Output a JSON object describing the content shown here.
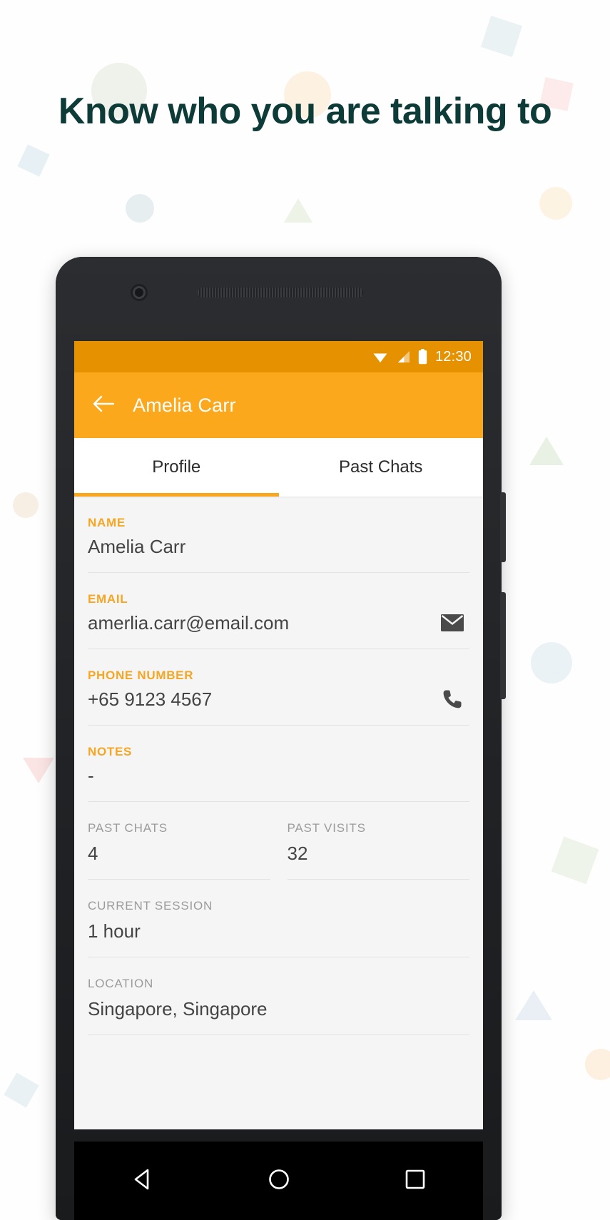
{
  "headline": "Know who you are talking to",
  "status_bar": {
    "time": "12:30",
    "icons": [
      "wifi-icon",
      "cell-signal-icon",
      "battery-icon"
    ]
  },
  "app_bar": {
    "back_icon": "back-arrow-icon",
    "title": "Amelia Carr"
  },
  "tabs": {
    "items": [
      {
        "label": "Profile",
        "active": true
      },
      {
        "label": "Past Chats",
        "active": false
      }
    ]
  },
  "profile_fields": [
    {
      "label": "NAME",
      "value": "Amelia Carr",
      "action": null
    },
    {
      "label": "EMAIL",
      "value": "amerlia.carr@email.com",
      "action": "email-icon"
    },
    {
      "label": "PHONE NUMBER",
      "value": "+65 9123 4567",
      "action": "phone-icon"
    },
    {
      "label": "NOTES",
      "value": "-",
      "action": null
    }
  ],
  "stats": [
    {
      "label": "PAST CHATS",
      "value": "4"
    },
    {
      "label": "PAST VISITS",
      "value": "32"
    },
    {
      "label": "CURRENT SESSION",
      "value": "1 hour"
    },
    {
      "label": "LOCATION",
      "value": "Singapore, Singapore"
    }
  ],
  "nav_bar": {
    "back": "nav-back-triangle-icon",
    "home": "nav-home-circle-icon",
    "recents": "nav-recents-square-icon"
  },
  "colors": {
    "headline": "#0c3b38",
    "status_bar": "#e59100",
    "app_bar": "#fca81d",
    "accent": "#f5a623",
    "tab_indicator": "#f7a720",
    "content_bg": "#f5f5f5",
    "value_text": "#444444",
    "muted_label": "#9b9b9b"
  }
}
